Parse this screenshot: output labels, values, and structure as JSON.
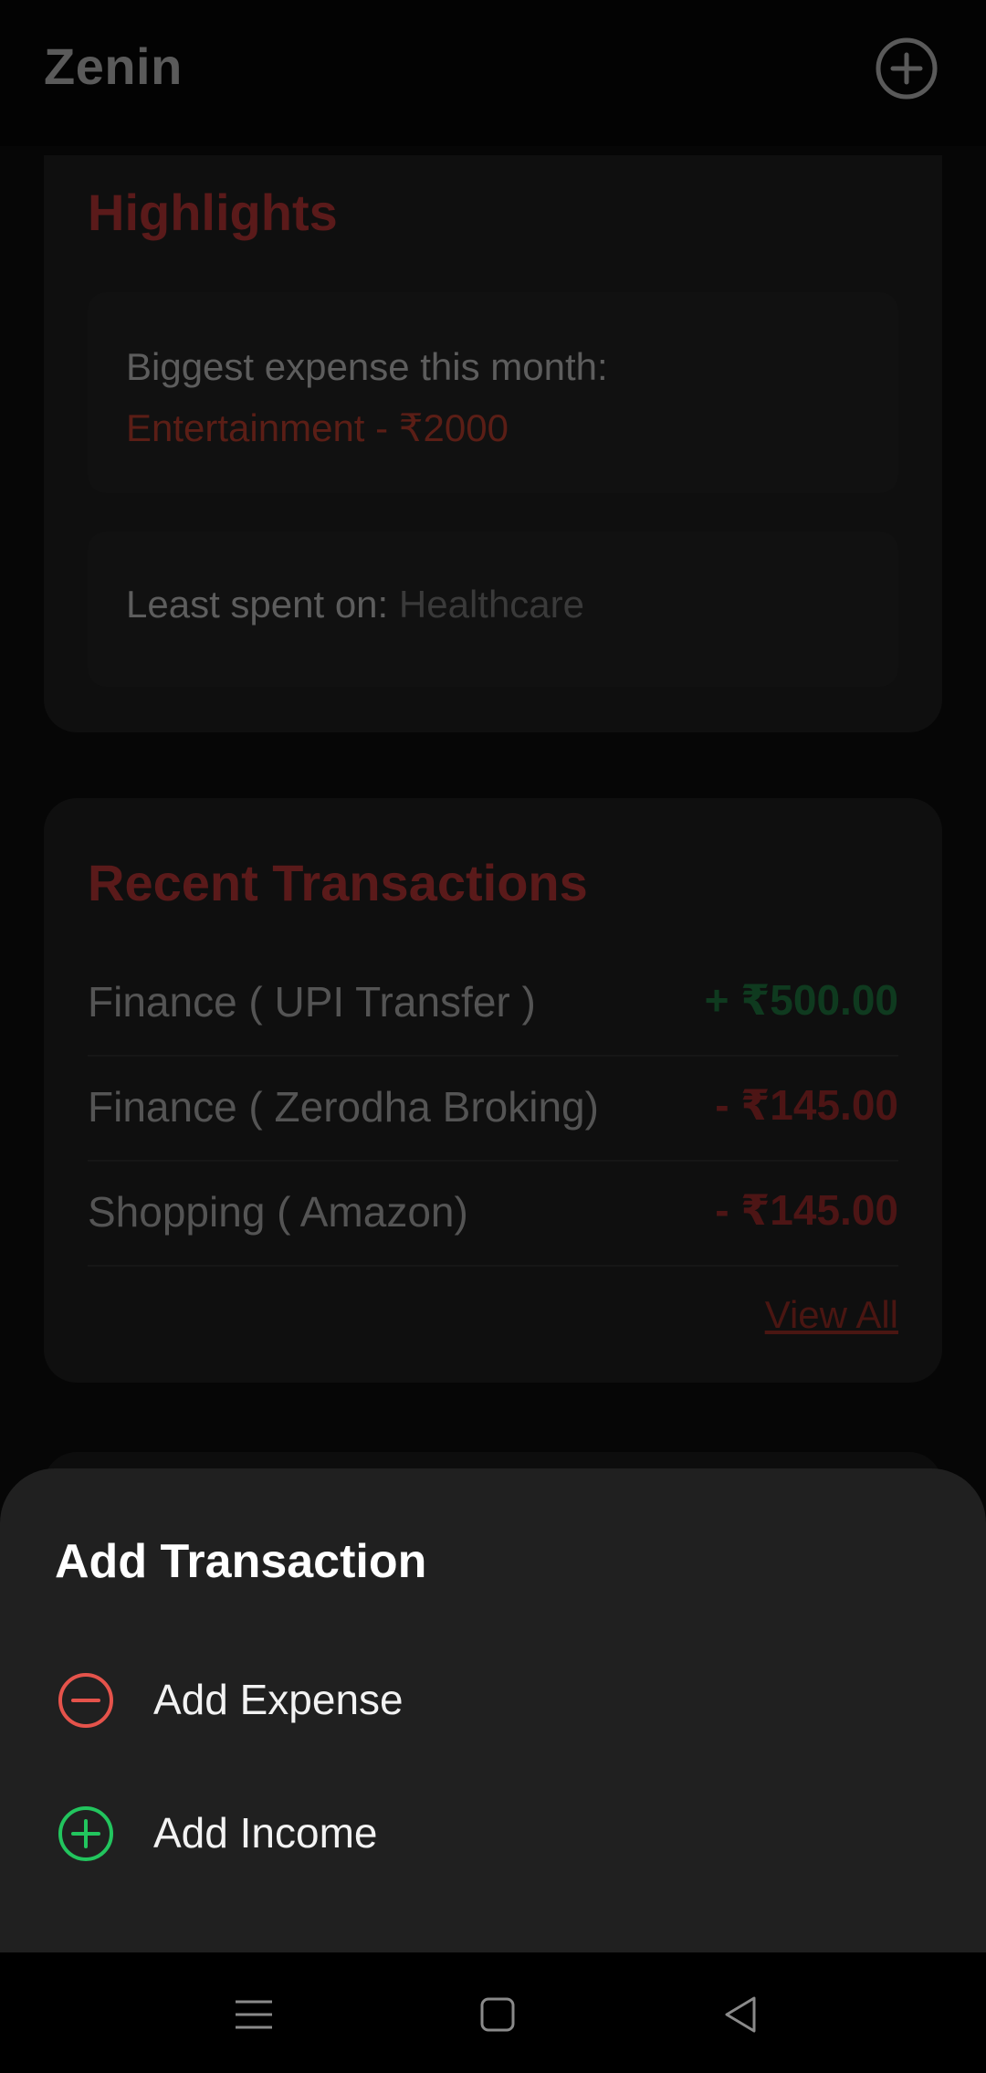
{
  "app": {
    "title": "Zenin",
    "add_icon": "plus-circle-icon"
  },
  "highlights": {
    "title": "Highlights",
    "biggest_label": "Biggest expense this month:",
    "biggest_value": "Entertainment - ₹2000",
    "least_label": "Least spent on:",
    "least_value": "Healthcare"
  },
  "recent": {
    "title": "Recent Transactions",
    "rows": [
      {
        "label": "Finance ( UPI Transfer )",
        "amount": "+ ₹500.00",
        "type": "income"
      },
      {
        "label": "Finance ( Zerodha Broking)",
        "amount": "- ₹145.00",
        "type": "expense"
      },
      {
        "label": "Shopping ( Amazon)",
        "amount": "- ₹145.00",
        "type": "expense"
      }
    ],
    "view_all": "View All"
  },
  "sheet": {
    "title": "Add Transaction",
    "items": [
      {
        "label": "Add Expense",
        "icon": "minus-circle-icon"
      },
      {
        "label": "Add Income",
        "icon": "plus-circle-icon"
      }
    ]
  },
  "colors": {
    "expense_accent": "#e5534b",
    "income_accent": "#22c55e",
    "sheet_bg": "#202020"
  },
  "navbar": {
    "icons": [
      "menu-icon",
      "home-square-icon",
      "back-triangle-icon"
    ]
  }
}
